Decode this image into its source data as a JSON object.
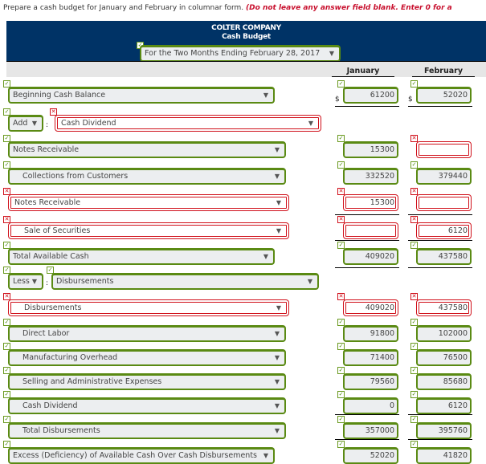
{
  "instructions": {
    "text": "Prepare a cash budget for January and February in columnar form.",
    "warning": "(Do not leave any answer field blank. Enter 0 for a"
  },
  "header": {
    "company": "COLTER COMPANY",
    "title": "Cash Budget",
    "period": "For the Two Months Ending February 28, 2017",
    "period_status": "correct"
  },
  "columns": [
    "January",
    "February"
  ],
  "currency_symbol": "$",
  "rows": [
    {
      "label": "Beginning Cash Balance",
      "status": "correct",
      "jan": "61200",
      "jan_status": "correct",
      "feb": "52020",
      "feb_status": "correct"
    },
    {
      "prefix": "Add",
      "prefix_status": "correct",
      "label": "Cash Dividend",
      "status": "incorrect"
    },
    {
      "label": "Notes Receivable",
      "status": "correct",
      "jan": "15300",
      "jan_status": "correct",
      "feb": "",
      "feb_status": "incorrect"
    },
    {
      "label": "Collections from Customers",
      "status": "correct",
      "jan": "332520",
      "jan_status": "correct",
      "feb": "379440",
      "feb_status": "correct"
    },
    {
      "label": "Notes Receivable",
      "status": "incorrect",
      "jan": "15300",
      "jan_status": "incorrect",
      "feb": "",
      "feb_status": "incorrect"
    },
    {
      "label": "Sale of Securities",
      "status": "incorrect",
      "jan": "",
      "jan_status": "incorrect",
      "feb": "6120",
      "feb_status": "incorrect"
    },
    {
      "label": "Total Available Cash",
      "status": "correct",
      "jan": "409020",
      "jan_status": "correct",
      "feb": "437580",
      "feb_status": "correct"
    },
    {
      "prefix": "Less",
      "prefix_status": "correct",
      "label": "Disbursements",
      "status": "correct"
    },
    {
      "label": "Disbursements",
      "status": "incorrect",
      "jan": "409020",
      "jan_status": "incorrect",
      "feb": "437580",
      "feb_status": "incorrect"
    },
    {
      "label": "Direct Labor",
      "status": "correct",
      "jan": "91800",
      "jan_status": "correct",
      "feb": "102000",
      "feb_status": "correct"
    },
    {
      "label": "Manufacturing Overhead",
      "status": "correct",
      "jan": "71400",
      "jan_status": "correct",
      "feb": "76500",
      "feb_status": "correct"
    },
    {
      "label": "Selling and Administrative Expenses",
      "status": "correct",
      "jan": "79560",
      "jan_status": "correct",
      "feb": "85680",
      "feb_status": "correct"
    },
    {
      "label": "Cash Dividend",
      "status": "correct",
      "jan": "0",
      "jan_status": "correct",
      "feb": "6120",
      "feb_status": "correct"
    },
    {
      "label": "Total Disbursements",
      "status": "correct",
      "jan": "357000",
      "jan_status": "correct",
      "feb": "395760",
      "feb_status": "correct"
    },
    {
      "label": "Excess (Deficiency) of Available Cash Over Cash Disbursements",
      "status": "correct",
      "jan": "52020",
      "jan_status": "correct",
      "feb": "41820",
      "feb_status": "correct"
    }
  ],
  "icons": {
    "correct": "✓",
    "incorrect": "✕",
    "dropdown": "▼"
  }
}
